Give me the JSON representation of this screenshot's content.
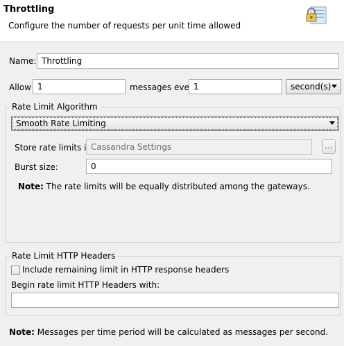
{
  "header": {
    "title": "Throttling",
    "description": "Configure the number of requests per unit time allowed",
    "icon": "lock-on-document-icon"
  },
  "name_field": {
    "label": "Name:",
    "value": "Throttling"
  },
  "allow_row": {
    "allow_label": "Allow",
    "allow_value": "1",
    "messages_every_label": "messages every",
    "period_value": "1",
    "unit_selected": "second(s)"
  },
  "rate_limit_algorithm": {
    "legend": "Rate Limit Algorithm",
    "algorithm_selected": "Smooth Rate Limiting",
    "store_label": "Store rate limits in:",
    "store_value": "Cassandra Settings",
    "browse_label": "...",
    "burst_label": "Burst size:",
    "burst_value": "0",
    "note_prefix": "Note:",
    "note_text": "The rate limits will be equally distributed among the gateways."
  },
  "http_headers": {
    "legend": "Rate Limit HTTP Headers",
    "include_label": "Include remaining limit in HTTP response headers",
    "include_checked": false,
    "begin_label": "Begin rate limit HTTP Headers with:",
    "begin_value": ""
  },
  "footer_note": {
    "prefix": "Note:",
    "text": "Messages per time period will be calculated as messages per second."
  }
}
